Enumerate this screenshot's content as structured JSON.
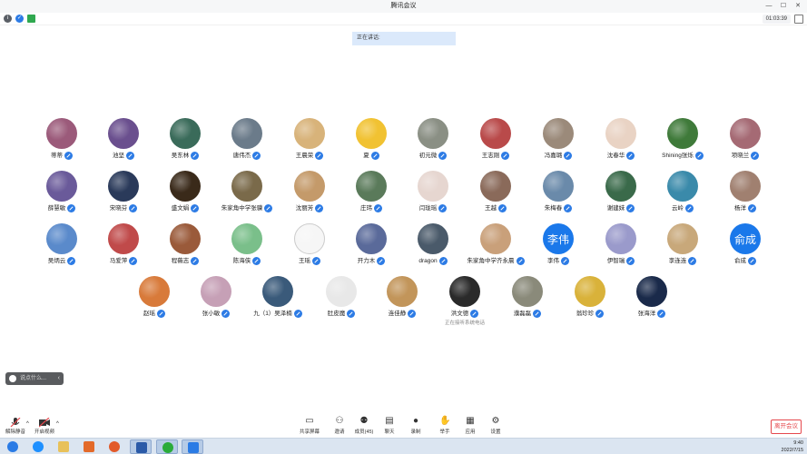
{
  "window": {
    "title": "腾讯会议"
  },
  "infobar": {
    "timer": "01:03:39"
  },
  "speaking": {
    "label": "正在讲话:"
  },
  "participants": [
    {
      "name": "蒂蒂",
      "avatar_color": "#9b5a7a"
    },
    {
      "name": "池坚",
      "avatar_color": "#6a4f8e"
    },
    {
      "name": "吴东林",
      "avatar_color": "#3a6b5a"
    },
    {
      "name": "唐伟杰",
      "avatar_color": "#6b7b8a"
    },
    {
      "name": "王晨荣",
      "avatar_color": "#d8b37a"
    },
    {
      "name": "夏",
      "avatar_color": "#f1c232"
    },
    {
      "name": "初元微",
      "avatar_color": "#8a8f84"
    },
    {
      "name": "王志刚",
      "avatar_color": "#b94a4a"
    },
    {
      "name": "冯嘉璐",
      "avatar_color": "#9b8a7a"
    },
    {
      "name": "沈春华",
      "avatar_color": "#e9d3c4"
    },
    {
      "name": "Shining张烁",
      "avatar_color": "#3f7a3a"
    },
    {
      "name": "项晓兰",
      "avatar_color": "#a56a74"
    },
    {
      "name": "薛慧敏",
      "avatar_color": "#6a5a9a"
    },
    {
      "name": "宋晓芬",
      "avatar_color": "#2a3a5a"
    },
    {
      "name": "盛文娟",
      "avatar_color": "#3a2a1a"
    },
    {
      "name": "朱家角中学张骥",
      "avatar_color": "#7a6a4a"
    },
    {
      "name": "沈丽芳",
      "avatar_color": "#c49a6a"
    },
    {
      "name": "庄玮",
      "avatar_color": "#5a7a5a"
    },
    {
      "name": "闫珑瑶",
      "avatar_color": "#e6d6d0"
    },
    {
      "name": "王越",
      "avatar_color": "#8a6a5a"
    },
    {
      "name": "朱梅春",
      "avatar_color": "#6a8aaa"
    },
    {
      "name": "谢建妹",
      "avatar_color": "#3a6a4a"
    },
    {
      "name": "云岭",
      "avatar_color": "#3a8aaa"
    },
    {
      "name": "杨洋",
      "avatar_color": "#a08070"
    },
    {
      "name": "吴炳云",
      "avatar_color": "#5a8acb"
    },
    {
      "name": "马爱萍",
      "avatar_color": "#c04a4a"
    },
    {
      "name": "程薇志",
      "avatar_color": "#9a5a3a"
    },
    {
      "name": "陈海侠",
      "avatar_color": "#7abf8a"
    },
    {
      "name": "王瑶",
      "avatar_color": "#f6f6f6"
    },
    {
      "name": "开力木",
      "avatar_color": "#5a6a9a"
    },
    {
      "name": "dragon",
      "avatar_color": "#4a5a6a"
    },
    {
      "name": "朱家角中学齐永晨",
      "avatar_color": "#c9a07a"
    },
    {
      "name": "李伟",
      "avatar_text": "李伟",
      "avatar_color": "#1a78ea"
    },
    {
      "name": "伊智瑞",
      "avatar_color": "#9a9acb"
    },
    {
      "name": "李连连",
      "avatar_color": "#c8a87a"
    },
    {
      "name": "俞成",
      "avatar_text": "俞成",
      "avatar_color": "#1a78ea"
    },
    {
      "name": "赵瑶",
      "avatar_color": "#d87a3a"
    },
    {
      "name": "张小敏",
      "avatar_color": "#c6a0b6"
    },
    {
      "name": "九（1）吴泽楠",
      "avatar_color": "#3a5a7a"
    },
    {
      "name": "肚皮魔",
      "avatar_color": "#e8e8e8"
    },
    {
      "name": "连佳静",
      "avatar_color": "#c2955a"
    },
    {
      "name": "洪文德",
      "avatar_color": "#2a2a2a",
      "subtitle": "正在接听系统电话"
    },
    {
      "name": "濮磊磊",
      "avatar_color": "#8a8a7a"
    },
    {
      "name": "翁珍珍",
      "avatar_color": "#d9b23a"
    },
    {
      "name": "张海洋",
      "avatar_color": "#1a2a4a"
    }
  ],
  "chat": {
    "placeholder": "说点什么..."
  },
  "toolbar": {
    "left": [
      {
        "label": "解除静音"
      },
      {
        "label": "开启视频"
      }
    ],
    "center": [
      {
        "label": "共享屏幕"
      },
      {
        "label": "邀请"
      },
      {
        "label": "成员(45)"
      },
      {
        "label": "聊天"
      },
      {
        "label": "录制"
      },
      {
        "label": "举手"
      },
      {
        "label": "应用"
      },
      {
        "label": "设置"
      }
    ],
    "leave": "离开会议"
  },
  "taskbar": {
    "time": "9:40",
    "date": "2022/7/15",
    "apps": [
      {
        "name": "ie-icon",
        "color": "#1e90ff"
      },
      {
        "name": "folder-icon",
        "color": "#e8c15a"
      },
      {
        "name": "media-icon",
        "color": "#e36a2a"
      },
      {
        "name": "firefox-icon",
        "color": "#e25a2a"
      },
      {
        "name": "word-icon",
        "color": "#2a5aa8"
      },
      {
        "name": "wechat-icon",
        "color": "#2aab3a"
      },
      {
        "name": "tencent-meeting-icon",
        "color": "#2a7be5"
      }
    ]
  }
}
